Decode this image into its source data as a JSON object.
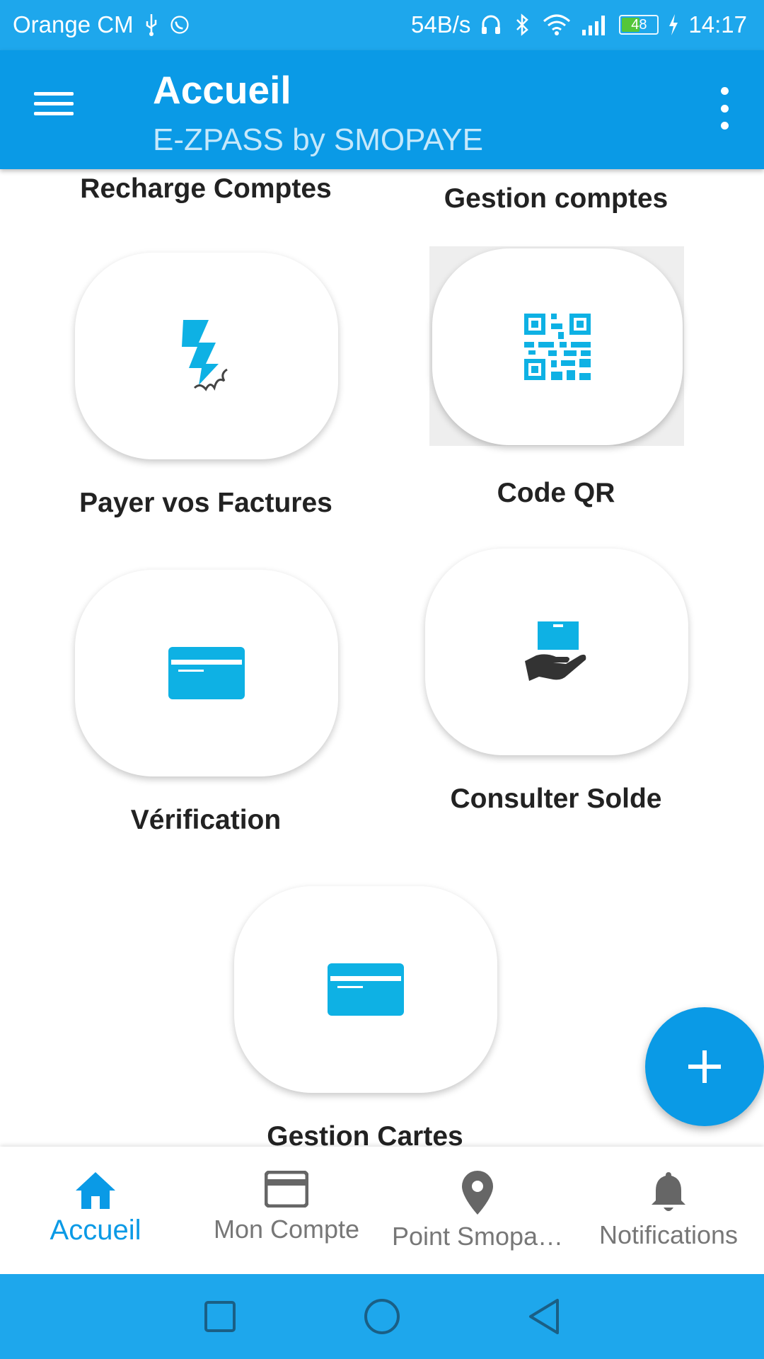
{
  "status_bar": {
    "carrier": "Orange CM",
    "speed": "54B/s",
    "battery": "48",
    "time": "14:17",
    "icons": [
      "usb-icon",
      "whatsapp-icon",
      "headphones-icon",
      "bluetooth-icon",
      "wifi-icon",
      "signal-icon",
      "battery-icon",
      "charging-icon"
    ]
  },
  "app_bar": {
    "title": "Accueil",
    "subtitle": "E-ZPASS by SMOPAYE"
  },
  "tiles": {
    "recharge": {
      "label": "Recharge Comptes"
    },
    "gestion_comptes": {
      "label": "Gestion comptes"
    },
    "payer": {
      "label": "Payer vos Factures",
      "icon": "bill-payment-icon"
    },
    "qr": {
      "label": "Code QR",
      "icon": "qr-code-icon"
    },
    "verification": {
      "label": "Vérification",
      "icon": "card-icon"
    },
    "solde": {
      "label": "Consulter Solde",
      "icon": "hand-with-box-icon"
    },
    "cartes": {
      "label": "Gestion Cartes",
      "icon": "card-icon"
    }
  },
  "bottom_nav": [
    {
      "label": "Accueil",
      "icon": "home-icon",
      "active": true
    },
    {
      "label": "Mon Compte",
      "icon": "credit-card-icon",
      "active": false
    },
    {
      "label": "Point Smopa…",
      "icon": "location-pin-icon",
      "active": false
    },
    {
      "label": "Notifications",
      "icon": "bell-icon",
      "active": false
    }
  ],
  "colors": {
    "primary": "#0a9ae6",
    "status_bar": "#1ea7ec",
    "icon_blue": "#0eb1e4",
    "text_dark": "#222222",
    "nav_grey": "#777777"
  }
}
